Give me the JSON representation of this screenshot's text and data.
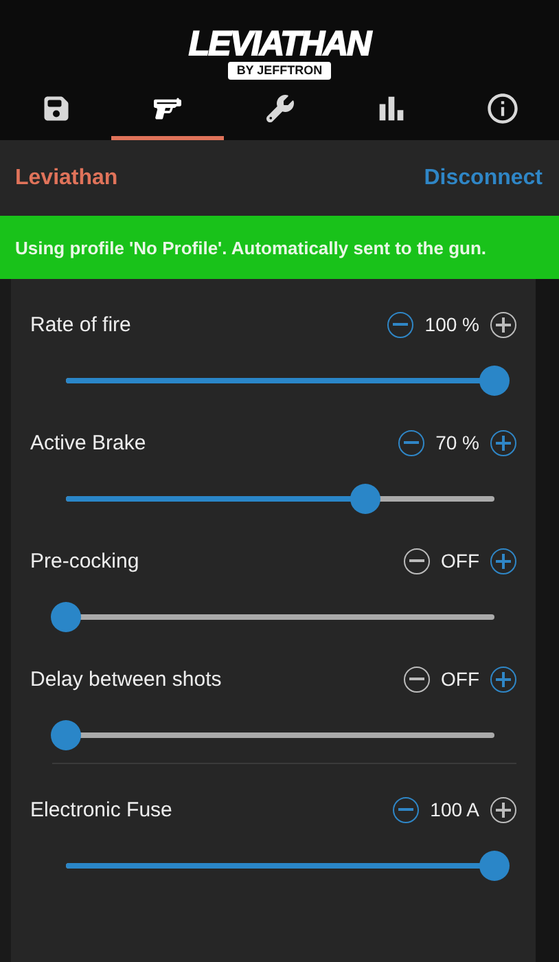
{
  "logo": {
    "title": "LEVIATHAN",
    "subtitle": "BY JEFFTRON"
  },
  "tabs": [
    {
      "kind": "save",
      "selected": false
    },
    {
      "kind": "gun",
      "selected": true
    },
    {
      "kind": "wrench",
      "selected": false
    },
    {
      "kind": "chart",
      "selected": false
    },
    {
      "kind": "info",
      "selected": false
    }
  ],
  "device": {
    "name": "Leviathan",
    "action": "Disconnect"
  },
  "banner": "Using profile 'No Profile'. Automatically sent to the gun.",
  "settings": [
    {
      "kind": "slider",
      "label": "Rate of fire",
      "reading": "100 %",
      "level": 1,
      "minus_disabled": false,
      "plus_disabled": true
    },
    {
      "kind": "slider",
      "label": "Active Brake",
      "reading": "70 %",
      "level": 0.7,
      "minus_disabled": false,
      "plus_disabled": false
    },
    {
      "kind": "slider",
      "label": "Pre-cocking",
      "reading": "OFF",
      "level": 0,
      "minus_disabled": true,
      "plus_disabled": false
    },
    {
      "kind": "slider",
      "label": "Delay between shots",
      "reading": "OFF",
      "level": 0,
      "minus_disabled": true,
      "plus_disabled": false
    },
    {
      "kind": "divider"
    },
    {
      "kind": "slider",
      "label": "Electronic Fuse",
      "reading": "100 A",
      "level": 1,
      "minus_disabled": false,
      "plus_disabled": true
    }
  ]
}
